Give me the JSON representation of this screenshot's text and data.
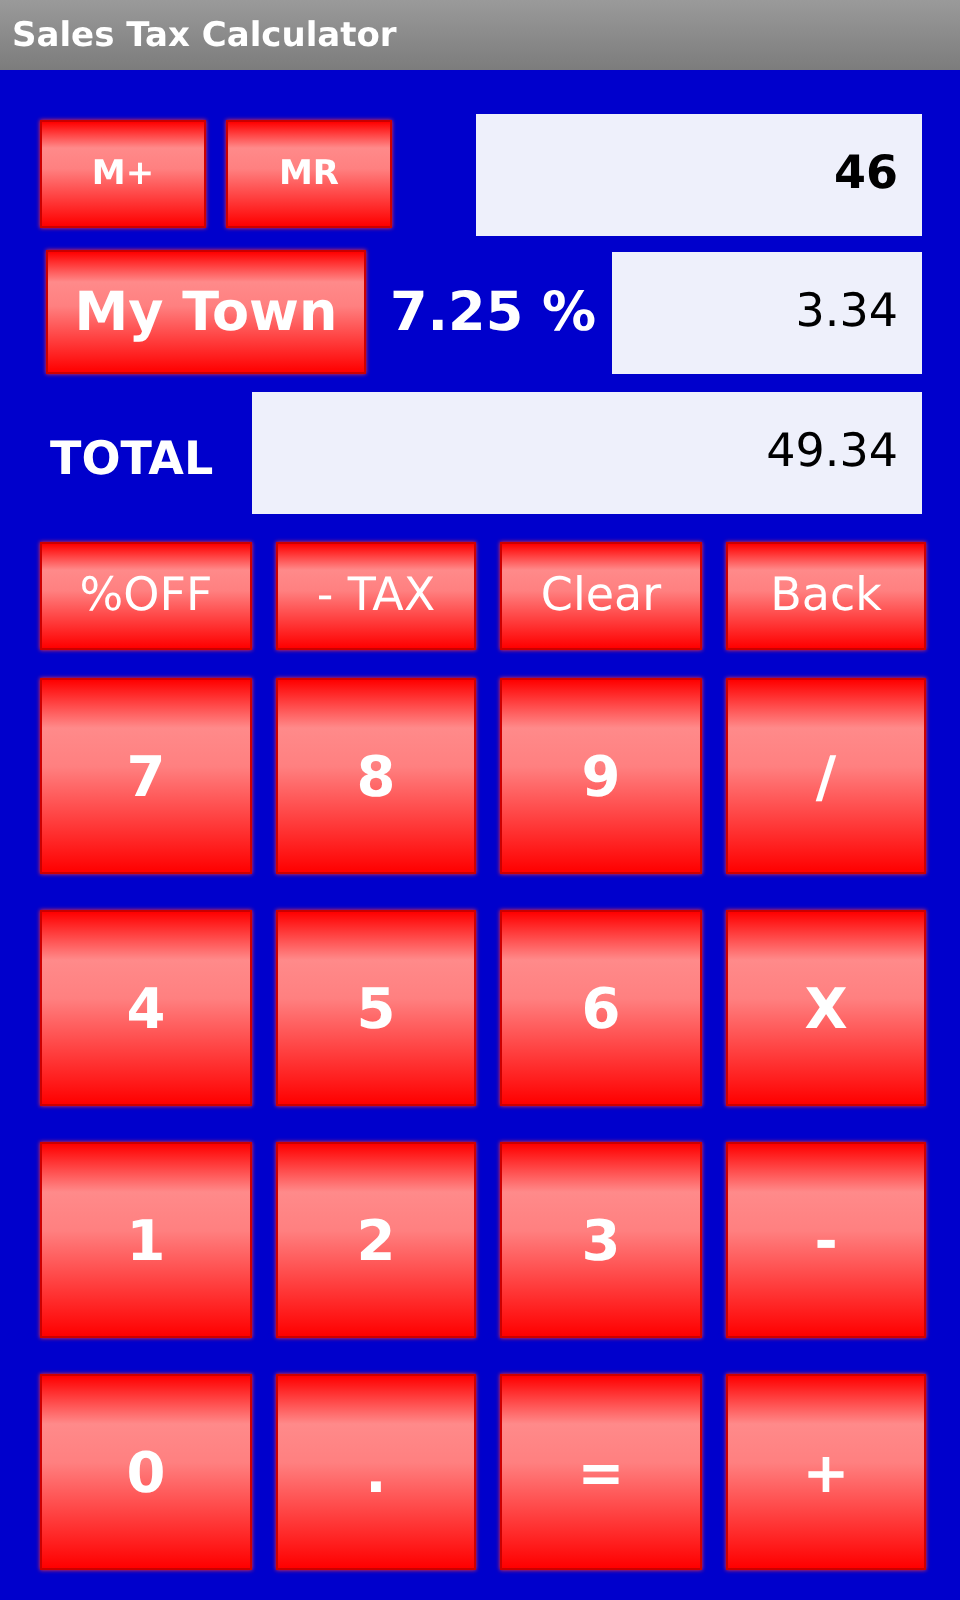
{
  "window": {
    "title": "Sales Tax Calculator"
  },
  "memory_buttons": [
    "M+",
    "MR"
  ],
  "amount_field": {
    "value": "46"
  },
  "location_button": "My Town",
  "tax_rate": "7.25 %",
  "tax_field": {
    "value": "3.34"
  },
  "total_label": "TOTAL",
  "total_field": {
    "value": "49.34"
  },
  "function_buttons": [
    "%OFF",
    "- TAX",
    "Clear",
    "Back"
  ],
  "keypad": [
    "7",
    "8",
    "9",
    "/",
    "4",
    "5",
    "6",
    "X",
    "1",
    "2",
    "3",
    "-",
    "0",
    ".",
    "=",
    "+"
  ]
}
